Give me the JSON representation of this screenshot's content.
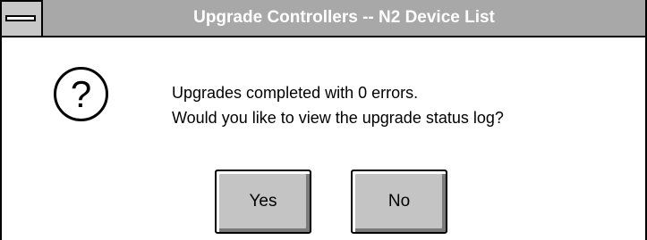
{
  "window": {
    "title": "Upgrade Controllers -- N2 Device List",
    "system_menu_icon": "system-menu-bar-icon"
  },
  "dialog": {
    "icon": "question-icon",
    "message_line1": "Upgrades completed with 0 errors.",
    "message_line2": "Would you like to view the upgrade status log?"
  },
  "buttons": {
    "yes_label": "Yes",
    "no_label": "No"
  },
  "colors": {
    "titlebar": "#a8a8a8",
    "button_face": "#c4c4c4"
  }
}
